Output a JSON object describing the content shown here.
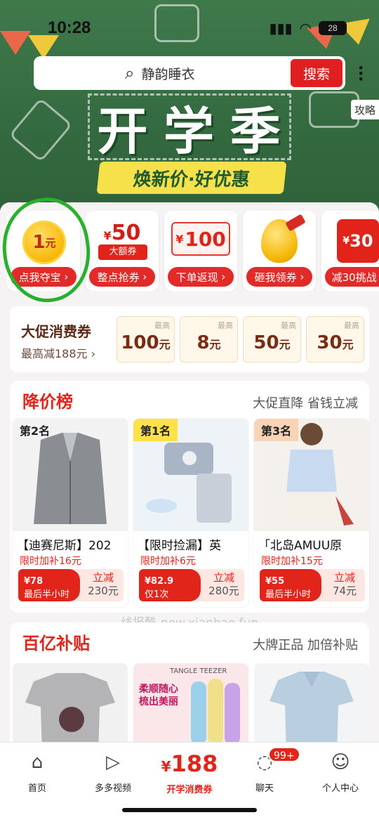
{
  "status": {
    "time": "10:28",
    "battery": "28"
  },
  "search": {
    "placeholder": "静韵睡衣",
    "button": "搜索"
  },
  "banner": {
    "title_chars": [
      "开",
      "学",
      "季"
    ],
    "subtitle": "焕新价·好优惠",
    "guide": "攻略"
  },
  "coupons": [
    {
      "top": "1",
      "top_unit": "元",
      "label": "点我夺宝"
    },
    {
      "top": "50",
      "top_prefix": "¥",
      "sub": "大额券",
      "label": "整点抢券"
    },
    {
      "top": "100",
      "top_prefix": "¥",
      "label": "下单返现"
    },
    {
      "label": "砸我领券"
    },
    {
      "top": "30",
      "top_prefix": "¥",
      "label": "减30挑战"
    }
  ],
  "big_sale": {
    "title": "大促消费券",
    "subtitle": "最高减188元",
    "max_label": "最高",
    "vouchers": [
      {
        "amount": "100",
        "unit": "元"
      },
      {
        "amount": "8",
        "unit": "元"
      },
      {
        "amount": "50",
        "unit": "元"
      },
      {
        "amount": "30",
        "unit": "元"
      }
    ]
  },
  "price_drop": {
    "title": "降价榜",
    "subtitle": "大促直降 省钱立减",
    "items": [
      {
        "rank": "第2名",
        "name": "【迪赛尼斯】202",
        "subsidy": "限时加补16元",
        "price": "¥78",
        "price_dec": "",
        "note": "最后半小时",
        "save_label": "立减",
        "save_value": "230元",
        "rank_color": "#cfe4fb"
      },
      {
        "rank": "第1名",
        "name": "【限时捡漏】英",
        "subsidy": "限时加补6元",
        "price": "¥82",
        "price_dec": ".9",
        "note": "仅1次",
        "save_label": "立减",
        "save_value": "280元",
        "rank_color": "#ffe14a"
      },
      {
        "rank": "第3名",
        "name": "「北岛AMUU原",
        "subsidy": "限时加补15元",
        "price": "¥55",
        "price_dec": "",
        "note": "最后半小时",
        "save_label": "立减",
        "save_value": "74元",
        "rank_color": "#f8d3b5"
      }
    ]
  },
  "watermark": "线报酷-new.xianbao.fun",
  "subsidy": {
    "title": "百亿补贴",
    "subtitle": "大牌正品 加倍补贴",
    "promo_text": "柔顺随心 梳出美丽",
    "brand_text": "TANGLE TEEZER"
  },
  "tabs": [
    {
      "label": "首页",
      "icon": "home-icon"
    },
    {
      "label": "多多视频",
      "icon": "video-icon"
    },
    {
      "label": "开学消费券",
      "amount": "188",
      "prefix": "¥"
    },
    {
      "label": "聊天",
      "icon": "chat-icon",
      "badge": "99+"
    },
    {
      "label": "个人中心",
      "icon": "profile-icon"
    }
  ],
  "colors": {
    "accent": "#e1251b",
    "banner_green": "#3f7a4b",
    "highlight_yellow": "#f7e14a",
    "circle_green": "#29b12e"
  }
}
